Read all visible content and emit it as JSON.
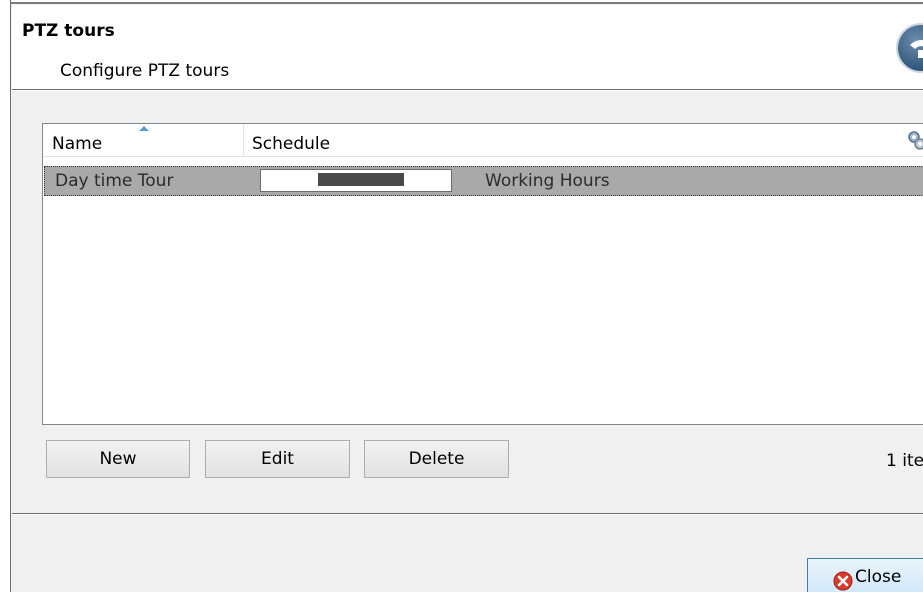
{
  "dialog": {
    "title": "PTZ tours",
    "subtitle": "Configure PTZ tours"
  },
  "list": {
    "columns": [
      "Name",
      "Schedule"
    ],
    "sort": {
      "column": "Name",
      "direction": "ascending"
    },
    "rows": [
      {
        "name": "Day time Tour",
        "schedule_name": "Working Hours",
        "schedule_active_fraction": [
          0.3,
          0.75
        ],
        "selected": true
      }
    ]
  },
  "buttons": {
    "new": "New",
    "edit": "Edit",
    "delete": "Delete",
    "close": "Close"
  },
  "item_count": "1 ite",
  "icons": {
    "header": "help-icon",
    "sort": "sort-ascending-icon",
    "column_settings": "column-settings-icon",
    "close": "close-icon"
  },
  "colors": {
    "selected_row": "#a9a9a9",
    "schedule_fill": "#4a4a4a",
    "close_button_border": "#3c7fb1",
    "close_icon": "#d93a2b"
  }
}
